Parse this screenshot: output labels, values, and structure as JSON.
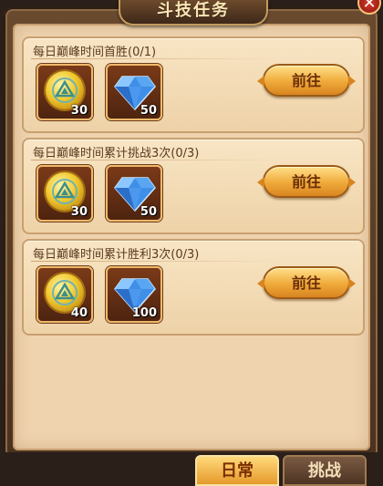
{
  "title": "斗技任务",
  "close_icon": "close-icon",
  "go_label": "前往",
  "tasks": [
    {
      "name": "每日巅峰时间首胜(0/1)",
      "rewards": [
        {
          "icon": "honor-medal-icon",
          "qty": "30"
        },
        {
          "icon": "diamond-icon",
          "qty": "50"
        }
      ]
    },
    {
      "name": "每日巅峰时间累计挑战3次(0/3)",
      "rewards": [
        {
          "icon": "honor-medal-icon",
          "qty": "30"
        },
        {
          "icon": "diamond-icon",
          "qty": "50"
        }
      ]
    },
    {
      "name": "每日巅峰时间累计胜利3次(0/3)",
      "rewards": [
        {
          "icon": "honor-medal-icon",
          "qty": "40"
        },
        {
          "icon": "diamond-icon",
          "qty": "100"
        }
      ]
    }
  ],
  "tabs": [
    {
      "label": "日常",
      "active": true
    },
    {
      "label": "挑战",
      "active": false
    }
  ],
  "colors": {
    "panel": "#efd3ae",
    "button": "#f0a93a",
    "tab_active": "#e59a2c"
  }
}
